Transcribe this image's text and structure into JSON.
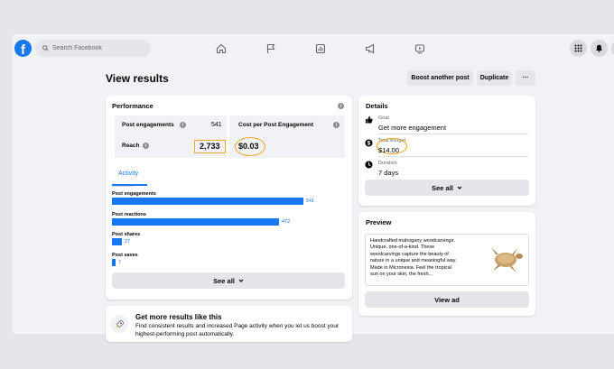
{
  "topbar": {
    "logo_letter": "f",
    "search_placeholder": "Search Facebook"
  },
  "header": {
    "title": "View results",
    "boost_another_label": "Boost another post",
    "duplicate_label": "Duplicate",
    "more_label": "···"
  },
  "performance": {
    "title": "Performance",
    "post_engagements_label": "Post engagements",
    "post_engagements_value": "541",
    "cost_label": "Cost per Post Engagement",
    "reach_label": "Reach",
    "reach_value": "2,733",
    "cost_value": "$0.03",
    "activity_tab": "Activity",
    "bars": [
      {
        "label": "Post engagements",
        "value": 541
      },
      {
        "label": "Post reactions",
        "value": 472
      },
      {
        "label": "Post shares",
        "value": 27
      },
      {
        "label": "Post saves",
        "value": 7
      }
    ],
    "see_all_label": "See all"
  },
  "details": {
    "title": "Details",
    "goal_label": "Goal",
    "goal_value": "Get more engagement",
    "budget_label": "Total budget",
    "budget_value": "$14.00",
    "duration_label": "Duration",
    "duration_value": "7 days",
    "see_all_label": "See all"
  },
  "preview": {
    "title": "Preview",
    "text": "Handcrafted mahogany woodcarvings. Unique, one-of-a-kind. These woodcarvings capture the beauty of nature in a unique and meaningful way. Made in Micronesia. Feel the tropical sun on your skin, the fresh...",
    "view_ad_label": "View ad"
  },
  "promo": {
    "title": "Get more results like this",
    "text": "Find consistent results and increased Page activity when you let us boost your highest-performing post automatically."
  },
  "colors": {
    "accent": "#1877f2",
    "highlight": "#f5a623",
    "page_bg": "#f0f2f5",
    "button_bg": "#e4e6eb"
  }
}
